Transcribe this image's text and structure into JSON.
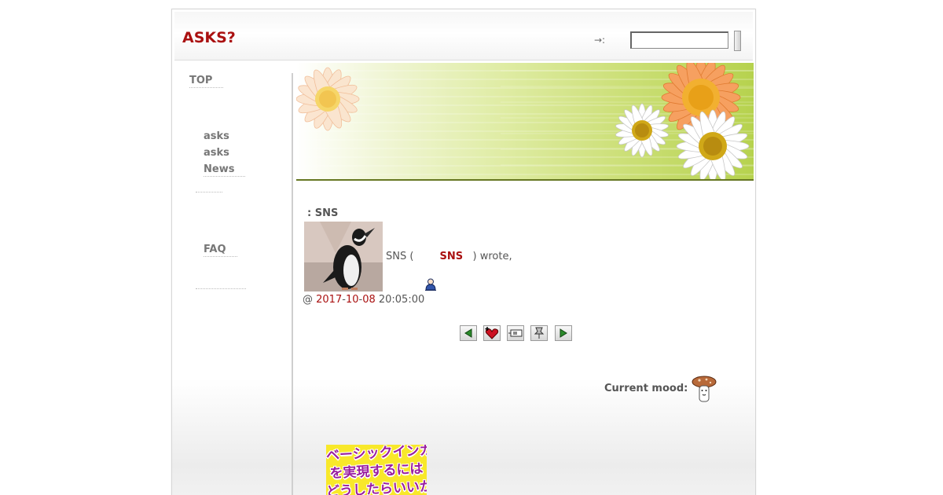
{
  "header": {
    "site_title": "ASKS?",
    "search_label": "→:",
    "search_value": ""
  },
  "sidebar": {
    "top": "TOP",
    "items": [
      "asks",
      "asks",
      "News"
    ],
    "faq": "FAQ"
  },
  "post": {
    "title": ": SNS",
    "wrote_prefix": "SNS ( ",
    "author": "SNS",
    "wrote_suffix": ") wrote,",
    "at": "@ ",
    "year": "2017",
    "month": "10",
    "day": "08",
    "time": " 20:05:00",
    "mood_label": "Current mood:"
  },
  "ad": {
    "lines": [
      "ベーシックインカム",
      "を実現するには",
      "どうしたらいいか"
    ]
  },
  "colors": {
    "title_red": "#aa1111",
    "link_red": "#aa1111",
    "banner_green": "#b6d24e"
  },
  "icons": [
    "previous-arrow-icon",
    "add-memory-heart-icon",
    "tell-a-friend-icon",
    "track-pushpin-icon",
    "next-arrow-icon",
    "mood-mushroom-icon",
    "user-icon"
  ]
}
